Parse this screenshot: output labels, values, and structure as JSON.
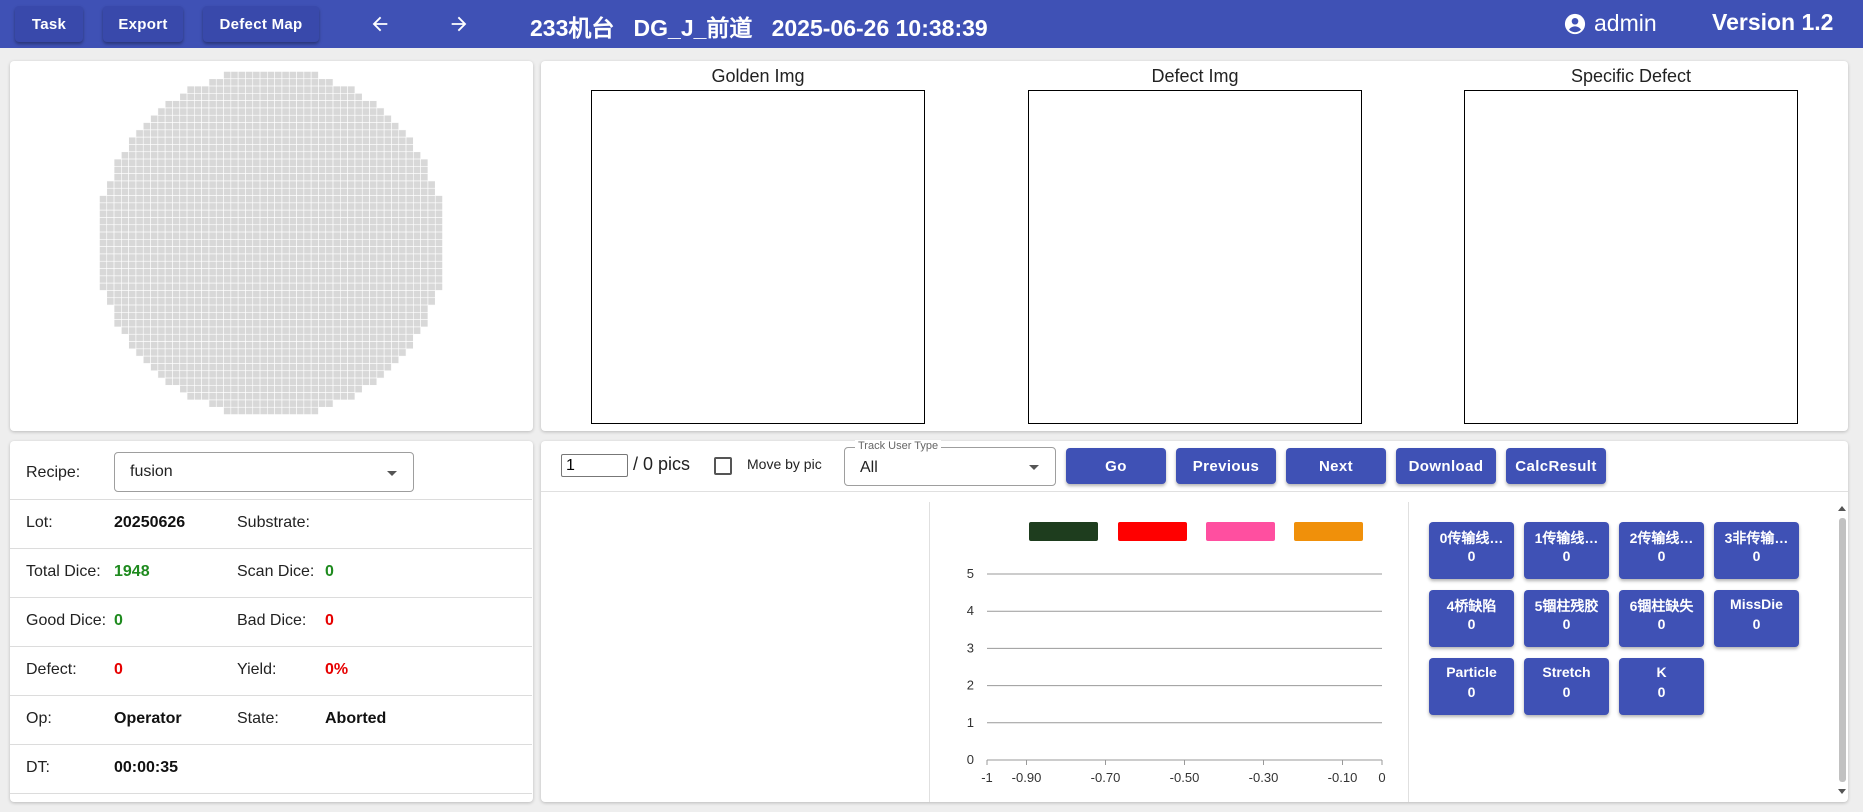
{
  "topbar": {
    "buttons": [
      "Task",
      "Export",
      "Defect Map"
    ],
    "title": "233机台   DG_J_前道   2025-06-26 10:38:39",
    "user": "admin",
    "version": "Version 1.2"
  },
  "images": {
    "golden": "Golden Img",
    "defect": "Defect Img",
    "specific": "Specific Defect"
  },
  "info": {
    "recipe_label": "Recipe:",
    "recipe_value": "fusion",
    "lot_label": "Lot:",
    "lot_value": "20250626",
    "substrate_label": "Substrate:",
    "substrate_value": "",
    "total_dice_label": "Total Dice:",
    "total_dice_value": "1948",
    "scan_dice_label": "Scan Dice:",
    "scan_dice_value": "0",
    "good_dice_label": "Good Dice:",
    "good_dice_value": "0",
    "bad_dice_label": "Bad Dice:",
    "bad_dice_value": "0",
    "defect_label": "Defect:",
    "defect_value": "0",
    "yield_label": "Yield:",
    "yield_value": "0%",
    "op_label": "Op:",
    "op_value": "Operator",
    "state_label": "State:",
    "state_value": "Aborted",
    "dt_label": "DT:",
    "dt_value": "00:00:35"
  },
  "toolbar": {
    "page_value": "1",
    "page_total": "/ 0 pics",
    "move_by_pic_label": "Move by pic",
    "move_by_pic_checked": false,
    "track_legend": "Track User Type",
    "track_value": "All",
    "buttons": [
      "Go",
      "Previous",
      "Next",
      "Download",
      "CalcResult"
    ]
  },
  "defect_buttons": [
    {
      "name": "0传输线…",
      "count": "0"
    },
    {
      "name": "1传输线…",
      "count": "0"
    },
    {
      "name": "2传输线…",
      "count": "0"
    },
    {
      "name": "3非传输…",
      "count": "0"
    },
    {
      "name": "4桥缺陷",
      "count": "0"
    },
    {
      "name": "5锢柱残胶",
      "count": "0"
    },
    {
      "name": "6锢柱缺失",
      "count": "0"
    },
    {
      "name": "MissDie",
      "count": "0"
    },
    {
      "name": "Particle",
      "count": "0"
    },
    {
      "name": "Stretch",
      "count": "0"
    },
    {
      "name": "K",
      "count": "0"
    }
  ],
  "chart_data": {
    "type": "scatter",
    "legend_colors": [
      "#1e3d1e",
      "#ff0000",
      "#ff4fa0",
      "#f0900a"
    ],
    "legend_position": "top",
    "x_ticks": [
      "-1",
      "-0.90",
      "-0.70",
      "-0.50",
      "-0.30",
      "-0.10",
      "0"
    ],
    "x_tick_values": [
      -1,
      -0.9,
      -0.7,
      -0.5,
      -0.3,
      -0.1,
      0
    ],
    "y_ticks": [
      "0",
      "1",
      "2",
      "3",
      "4",
      "5"
    ],
    "xlim": [
      -1,
      0
    ],
    "ylim": [
      0,
      5
    ],
    "grid": "horizontal",
    "series": []
  },
  "colors": {
    "primary": "#3f51b5",
    "wafer_die": "#d8d8d8"
  }
}
